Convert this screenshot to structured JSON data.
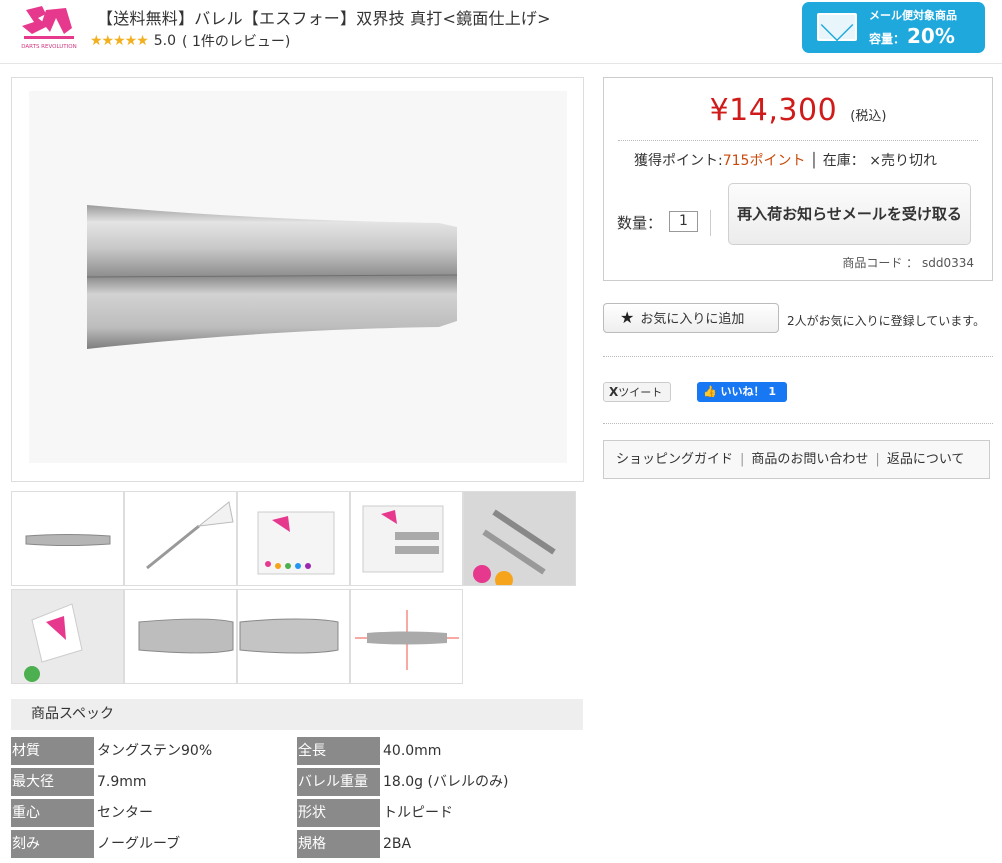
{
  "header": {
    "logo_text": "S4 DARTS REVOLUTION",
    "title": "【送料無料】バレル【エスフォー】双界技 真打<鏡面仕上げ>",
    "rating_stars": "★★★★★",
    "rating_score": "5.0",
    "review_count": "( 1件のレビュー)"
  },
  "mail_badge": {
    "line1": "メール便対象商品",
    "line2_label": "容量：",
    "line2_value": "20%"
  },
  "purchase": {
    "price": "¥14,300",
    "tax_label": "(税込)",
    "points_label": "獲得ポイント:",
    "points_value": "715ポイント",
    "stock_label": "│ 在庫：",
    "stock_value": "×売り切れ",
    "qty_label": "数量：",
    "qty_value": "1",
    "restock_button": "再入荷お知らせメールを受け取る",
    "product_code": "商品コード ： sdd0334"
  },
  "favorite": {
    "button_label": "お気に入りに追加",
    "count_text": "2人がお気に入りに登録しています。"
  },
  "social": {
    "tweet_label": "ツイート",
    "like_label": "いいね！ 1"
  },
  "links": {
    "guide": "ショッピングガイド",
    "inquiry": "商品のお問い合わせ",
    "returns": "返品について"
  },
  "specs": {
    "heading": "商品スペック",
    "rows": [
      {
        "key": "材質",
        "value": "タングステン90%"
      },
      {
        "key": "全長",
        "value": "40.0mm"
      },
      {
        "key": "最大径",
        "value": "7.9mm"
      },
      {
        "key": "バレル重量",
        "value": "18.0g (バレルのみ)"
      },
      {
        "key": "重心",
        "value": "センター"
      },
      {
        "key": "形状",
        "value": "トルピード"
      },
      {
        "key": "刻み",
        "value": "ノーグルーブ"
      },
      {
        "key": "規格",
        "value": "2BA"
      }
    ]
  },
  "thumbnails": [
    "barrel-side",
    "dart-with-flight",
    "package-front",
    "package-open",
    "package-closeup",
    "flight-logo",
    "barrel-pair-closeup",
    "barrel-detail",
    "barrel-diagram"
  ]
}
